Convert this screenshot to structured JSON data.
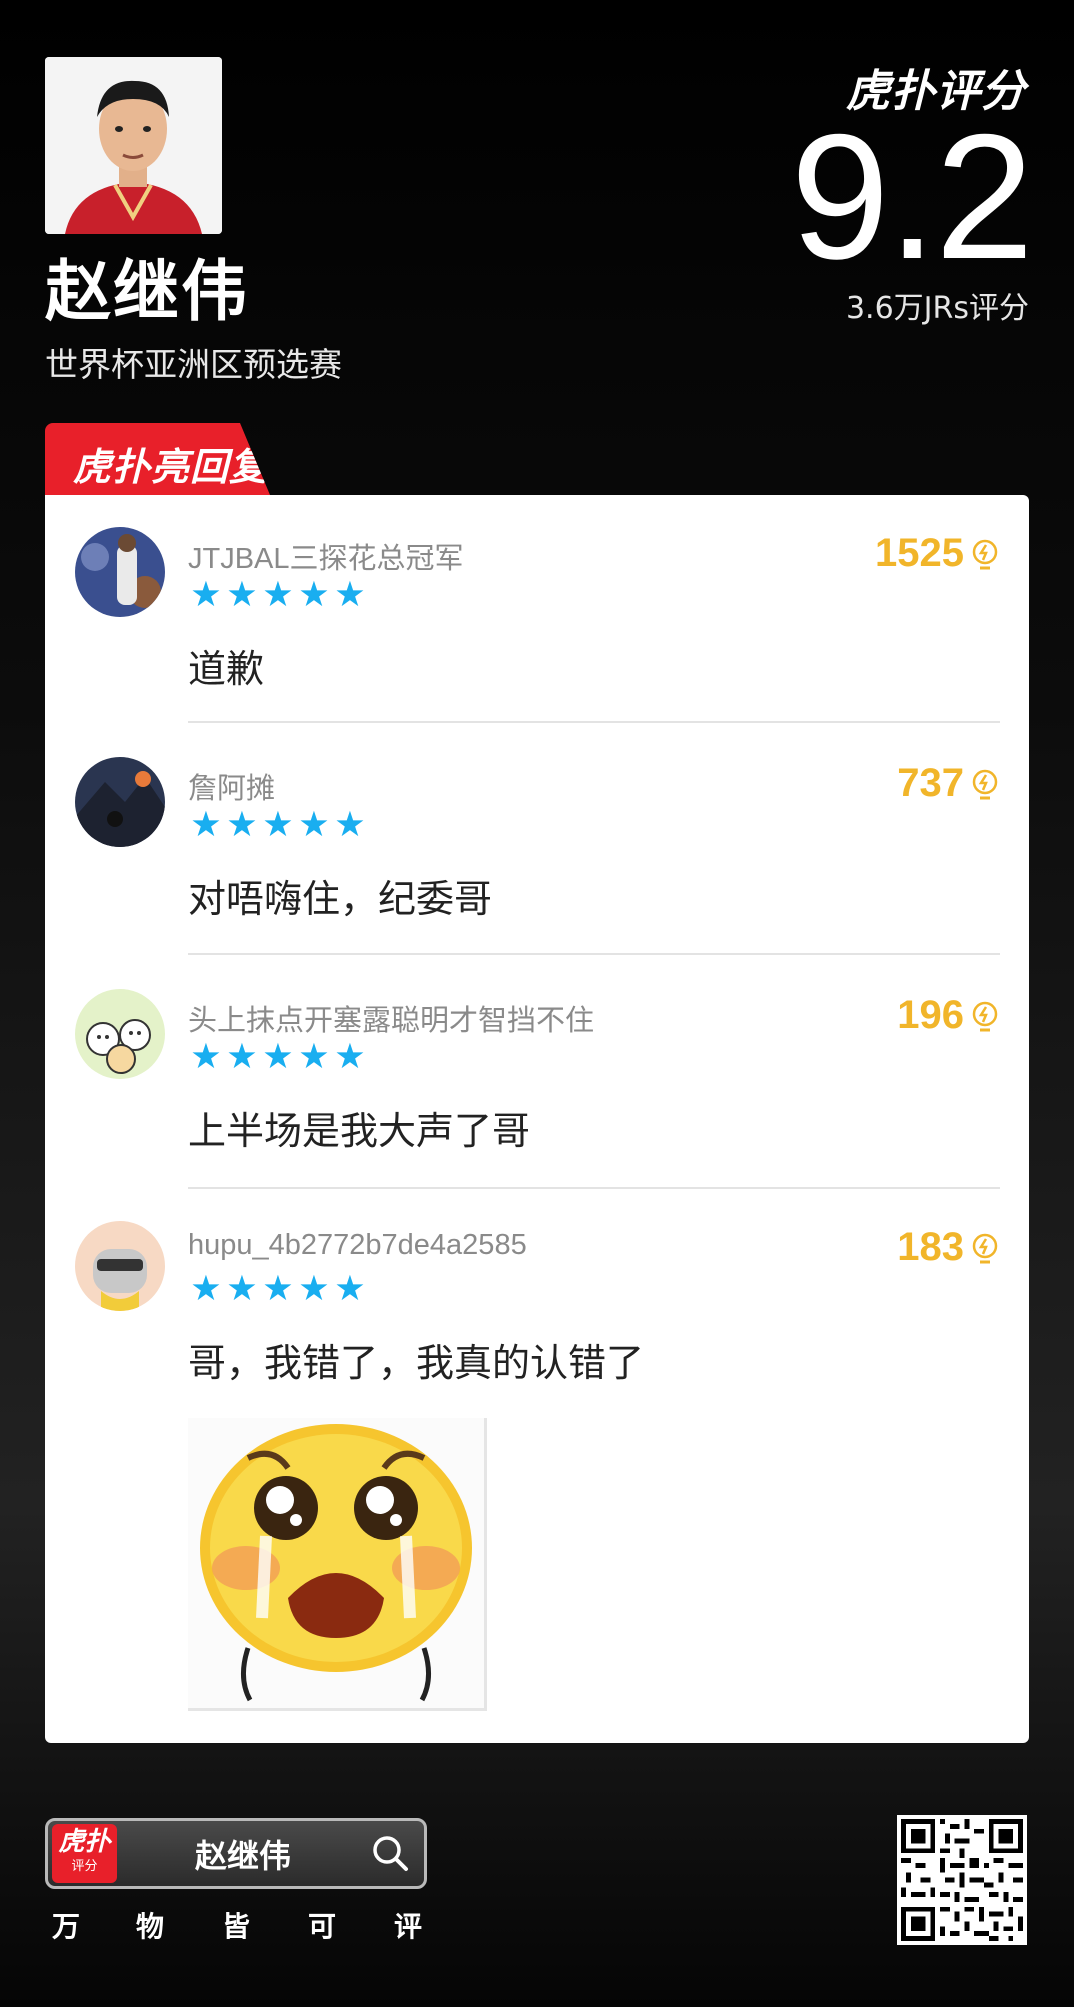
{
  "header": {
    "player_name": "赵继伟",
    "event": "世界杯亚洲区预选赛",
    "brand": "虎扑评分",
    "score": "9.2",
    "rating_count": "3.6万JRs评分"
  },
  "section": {
    "tab_label": "虎扑亮回复"
  },
  "comments": [
    {
      "username": "JTJBAL三探花总冠军",
      "rating_stars": 5,
      "text": "道歉",
      "likes": "1525"
    },
    {
      "username": "詹阿摊",
      "rating_stars": 5,
      "text": "对唔嗨住，纪委哥",
      "likes": "737"
    },
    {
      "username": "头上抹点开塞露聪明才智挡不住",
      "rating_stars": 5,
      "text": "上半场是我大声了哥",
      "likes": "196"
    },
    {
      "username": "hupu_4b2772b7de4a2585",
      "rating_stars": 5,
      "text": "哥，我错了，我真的认错了",
      "likes": "183"
    }
  ],
  "footer": {
    "logo_top": "虎扑",
    "logo_bottom": "评分",
    "search_text": "赵继伟",
    "slogan": [
      "万",
      "物",
      "皆",
      "可",
      "评"
    ]
  },
  "colors": {
    "accent_red": "#e8202a",
    "star_blue": "#19aef0",
    "likes_gold": "#f1b52a"
  },
  "icons": [
    "search-icon",
    "lightbulb-icon",
    "qr-code-icon",
    "star-icon"
  ]
}
